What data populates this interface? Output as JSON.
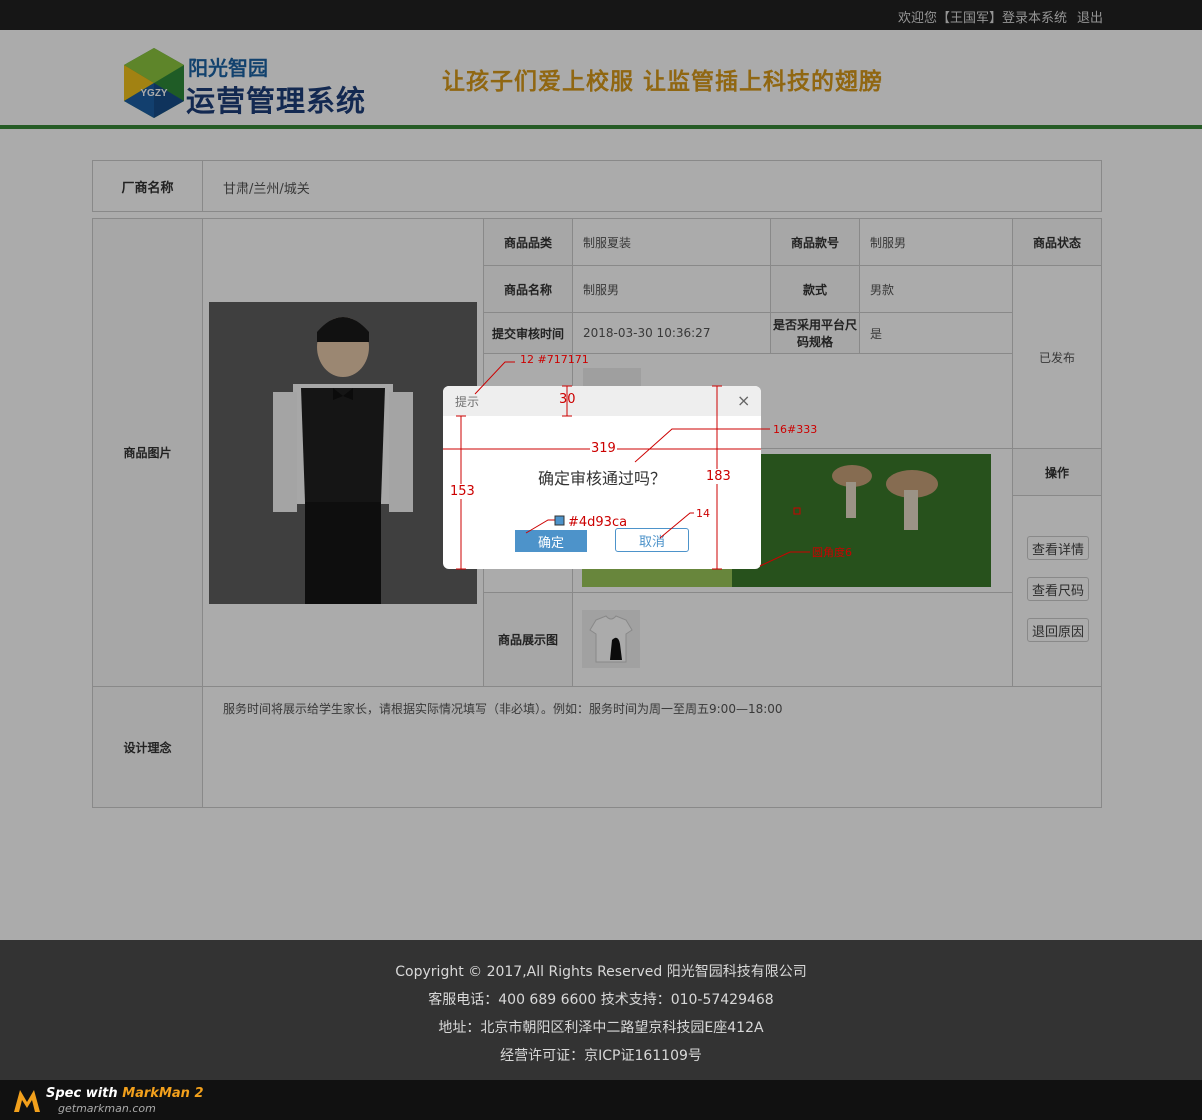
{
  "topbar": {
    "welcome": "欢迎您【王国军】登录本系统",
    "logout": "退出"
  },
  "header": {
    "logo_sub": "阳光智园",
    "logo_main": "运营管理系统",
    "logo_badge": "YGZY",
    "slogan": "让孩子们爱上校服  让监管插上科技的翅膀"
  },
  "vendor": {
    "label": "厂商名称",
    "value": "甘肃/兰州/城关"
  },
  "product": {
    "image_label": "商品图片",
    "category_label": "商品品类",
    "category_value": "制服夏装",
    "style_no_label": "商品款号",
    "style_no_value": "制服男",
    "status_label": "商品状态",
    "status_value": "已发布",
    "name_label": "商品名称",
    "name_value": "制服男",
    "style_label": "款式",
    "style_value": "男款",
    "submit_time_label": "提交审核时间",
    "submit_time_value": "2018-03-30 10:36:27",
    "size_spec_label": "是否采用平台尺码规格",
    "size_spec_value": "是",
    "display_label": "商品展示图",
    "ops_label": "操作",
    "ops": [
      "查看详情",
      "查看尺码",
      "退回原因"
    ]
  },
  "design": {
    "label": "设计理念",
    "value": "服务时间将展示给学生家长，请根据实际情况填写（非必填）。例如：服务时间为周一至周五9:00—18:00"
  },
  "dialog": {
    "title": "提示",
    "message": "确定审核通过吗？",
    "ok": "确定",
    "cancel": "取消",
    "close_icon": "×"
  },
  "annotations": {
    "title_spec": "12  #717171",
    "header_height": "30",
    "width": "319",
    "message_spec": "16#333",
    "body_height": "153",
    "total_height": "183",
    "button_color": "#4d93ca",
    "cancel_font": "14",
    "radius": "圆角度6"
  },
  "footer": {
    "copyright": "Copyright © 2017,All Rights Reserved 阳光智园科技有限公司",
    "contact": "客服电话：400 689 6600    技术支持：010-57429468",
    "address": "地址：北京市朝阳区利泽中二路望京科技园E座412A",
    "license": "经营许可证：京ICP证161109号"
  },
  "markman": {
    "title_prefix": "Spec with ",
    "title_brand": "MarkMan 2",
    "url": "getmarkman.com"
  },
  "colors": {
    "accent": "#4d93ca",
    "header_line": "#3a8a3a",
    "annotation": "#cc0000"
  }
}
